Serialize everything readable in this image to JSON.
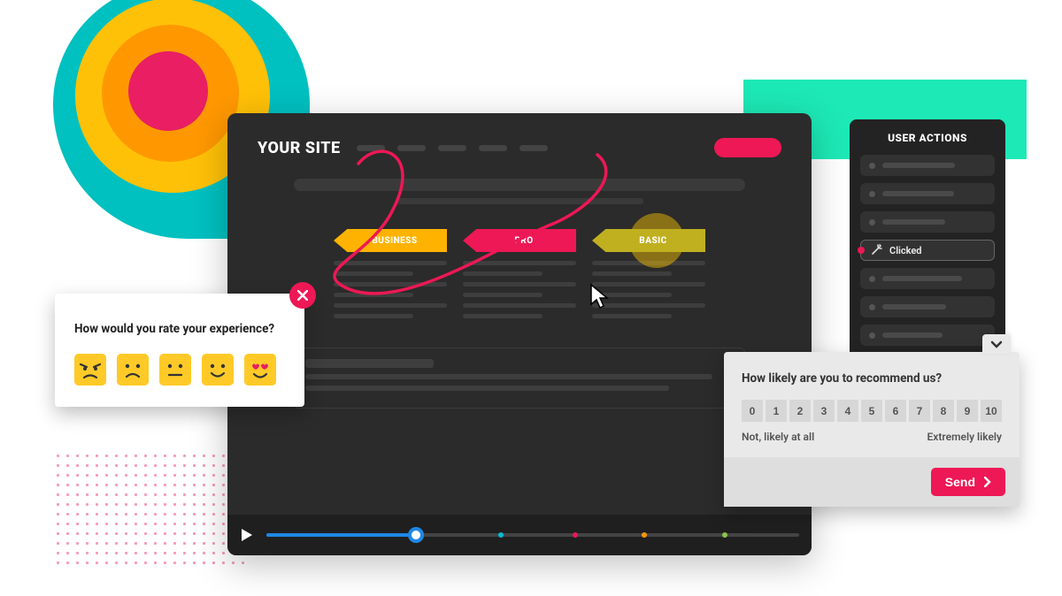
{
  "main": {
    "title": "YOUR SITE",
    "plans": [
      {
        "label": "BUSINESS",
        "color": "#ffb300"
      },
      {
        "label": "PRO",
        "color": "#ed1855"
      },
      {
        "label": "BASIC",
        "color": "#c0b020"
      }
    ]
  },
  "actions_panel": {
    "title": "USER ACTIONS",
    "items": [
      {
        "type": "placeholder"
      },
      {
        "type": "placeholder"
      },
      {
        "type": "placeholder"
      },
      {
        "type": "clicked",
        "label": "Clicked",
        "icon": "wand-icon"
      },
      {
        "type": "placeholder"
      },
      {
        "type": "placeholder"
      },
      {
        "type": "placeholder"
      }
    ]
  },
  "rate_popup": {
    "question": "How would you rate your experience?",
    "emojis": [
      "angry",
      "sad",
      "neutral",
      "happy",
      "love"
    ]
  },
  "nps": {
    "question": "How likely are you to recommend us?",
    "scale": [
      0,
      1,
      2,
      3,
      4,
      5,
      6,
      7,
      8,
      9,
      10
    ],
    "label_low": "Not, likely at all",
    "label_high": "Extremely likely",
    "send": "Send"
  },
  "playback": {
    "progress_pct": 28,
    "markers": [
      {
        "pos_pct": 44,
        "color": "#00bcd4"
      },
      {
        "pos_pct": 58,
        "color": "#ed1855"
      },
      {
        "pos_pct": 71,
        "color": "#ff9800"
      },
      {
        "pos_pct": 86,
        "color": "#8bc34a"
      }
    ]
  },
  "colors": {
    "accent": "#ed1855",
    "timeline": "#1e88e5"
  }
}
